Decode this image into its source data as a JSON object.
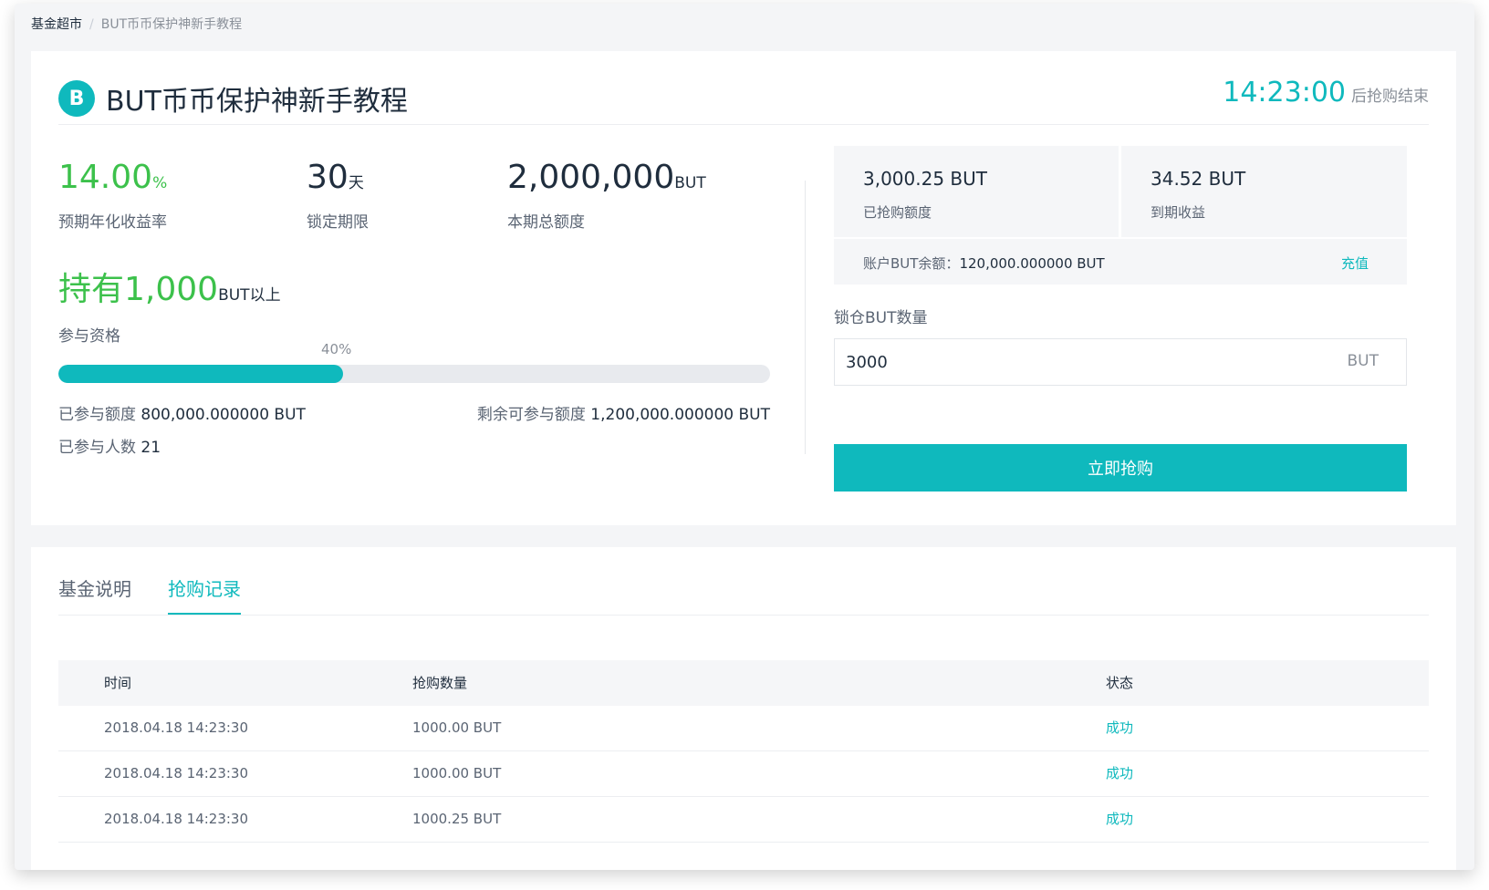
{
  "breadcrumb": {
    "root": "基金超市",
    "separator": "/",
    "current": "BUT币币保护神新手教程"
  },
  "header": {
    "logo_glyph": "B",
    "title": "BUT币币保护神新手教程",
    "countdown": "14:23:00",
    "countdown_suffix": "后抢购结束"
  },
  "stats": {
    "rate": {
      "value": "14.00",
      "unit": "%",
      "label": "预期年化收益率"
    },
    "period": {
      "value": "30",
      "unit": "天",
      "label": "锁定期限"
    },
    "total": {
      "value": "2,000,000",
      "unit": "BUT",
      "label": "本期总额度"
    },
    "eligibility": {
      "prefix": "持有",
      "value": "1,000",
      "unit": "BUT以上",
      "label": "参与资格"
    }
  },
  "progress": {
    "percent_label": "40%",
    "fraction": 0.4
  },
  "participation": {
    "joined_label": "已参与额度",
    "joined_value": "800,000.000000 BUT",
    "remaining_label": "剩余可参与额度",
    "remaining_value": "1,200,000.000000 BUT",
    "count_label": "已参与人数",
    "count_value": "21"
  },
  "summary": {
    "purchased_amount": "3,000.25 BUT",
    "purchased_label": "已抢购额度",
    "earnings_amount": "34.52 BUT",
    "earnings_label": "到期收益",
    "balance_label": "账户BUT余额：",
    "balance_value": "120,000.000000 BUT",
    "recharge_label": "充值"
  },
  "lock": {
    "label": "锁仓BUT数量",
    "input_value": "3000",
    "unit": "BUT",
    "button_label": "立即抢购"
  },
  "tabs": [
    {
      "label": "基金说明"
    },
    {
      "label": "抢购记录"
    }
  ],
  "records": {
    "headers": {
      "time": "时间",
      "amount": "抢购数量",
      "status": "状态"
    },
    "rows": [
      {
        "time": "2018.04.18 14:23:30",
        "amount": "1000.00 BUT",
        "status": "成功"
      },
      {
        "time": "2018.04.18 14:23:30",
        "amount": "1000.00 BUT",
        "status": "成功"
      },
      {
        "time": "2018.04.18 14:23:30",
        "amount": "1000.25 BUT",
        "status": "成功"
      }
    ]
  },
  "colors": {
    "accent": "#0fb9bd",
    "positive": "#3cc14b",
    "text": "#1f2d3d",
    "muted": "#5a6473"
  }
}
